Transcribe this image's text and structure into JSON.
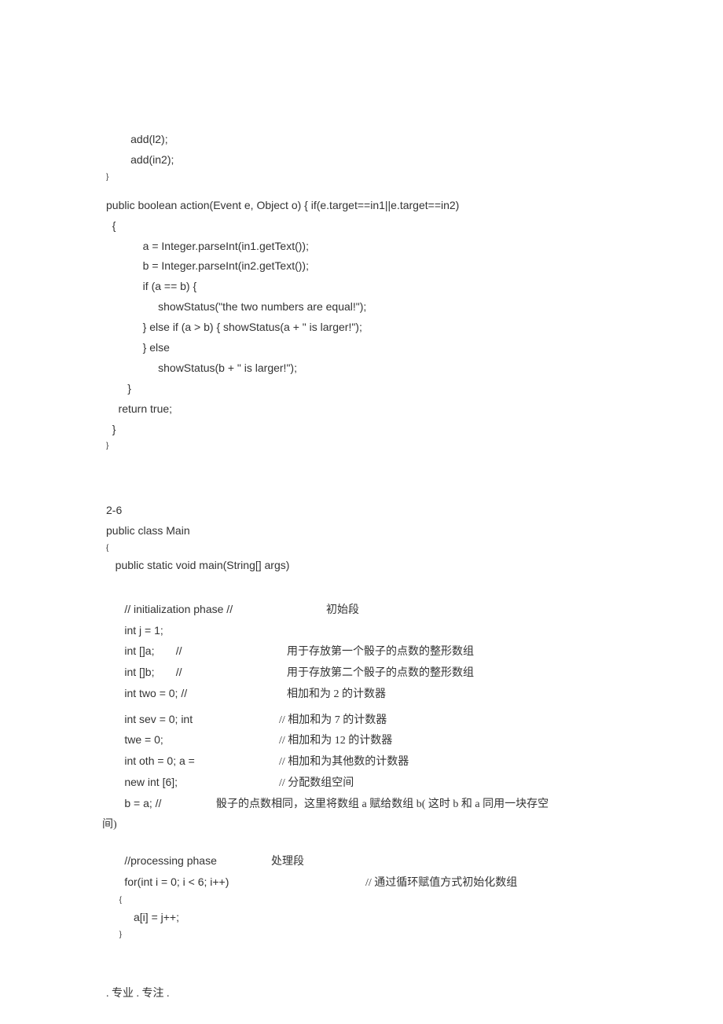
{
  "block1": {
    "l1": "        add(l2);",
    "l2": "        add(in2);",
    "l3": "}",
    "l4": "public boolean action(Event e, Object o) { if(e.target==in1||e.target==in2)",
    "l5": "  {",
    "l6": "            a = Integer.parseInt(in1.getText());",
    "l7": "            b = Integer.parseInt(in2.getText());",
    "l8": "            if (a == b) {",
    "l9": "                 showStatus(\"the two numbers are equal!\");",
    "l10": "            } else if (a > b) { showStatus(a + \" is larger!\");",
    "l11": "            } else",
    "l12": "                 showStatus(b + \" is larger!\");",
    "l13": "       }",
    "l14": "    return true;",
    "l15": "  }",
    "l16": "}"
  },
  "block2": {
    "header": "2-6",
    "l1": "public class Main",
    "l2": "{",
    "l3": "   public static void main(String[] args)",
    "l4_left": "      // initialization phase //",
    "l4_right": "初始段",
    "l5": "      int j = 1;",
    "l6_left": "      int []a;       //",
    "l6_right": "用于存放第一个骰子的点数的整形数组",
    "l7_left": "      int []b;       //",
    "l7_right": "用于存放第二个骰子的点数的整形数组",
    "l8_left": "      int two = 0; //",
    "l8_right": " 相加和为  2 的计数器",
    "l9_left": "      int sev = 0; int",
    "l9_right": "// 相加和为  7 的计数器",
    "l10_left": "      twe = 0;",
    "l10_right": "// 相加和为  12 的计数器",
    "l11_left": "      int oth = 0; a =",
    "l11_right": "// 相加和为其他数的计数器",
    "l12_left": "      new int [6];",
    "l12_right": "// 分配数组空间",
    "l13_left": "      b = a; //",
    "l13_right": "骰子的点数相同，这里将数组  a 赋给数组  b( 这时  b 和  a 同用一块存空",
    "l14": "间)",
    "l15_left": "      //processing phase",
    "l15_right": "处理段",
    "l16_left": "      for(int i = 0; i < 6; i++)",
    "l16_right": "// 通过循环赋值方式初始化数组",
    "l17": "      {",
    "l18": "         a[i] = j++;",
    "l19": "      }"
  },
  "footer": ". 专业  . 专注  ."
}
